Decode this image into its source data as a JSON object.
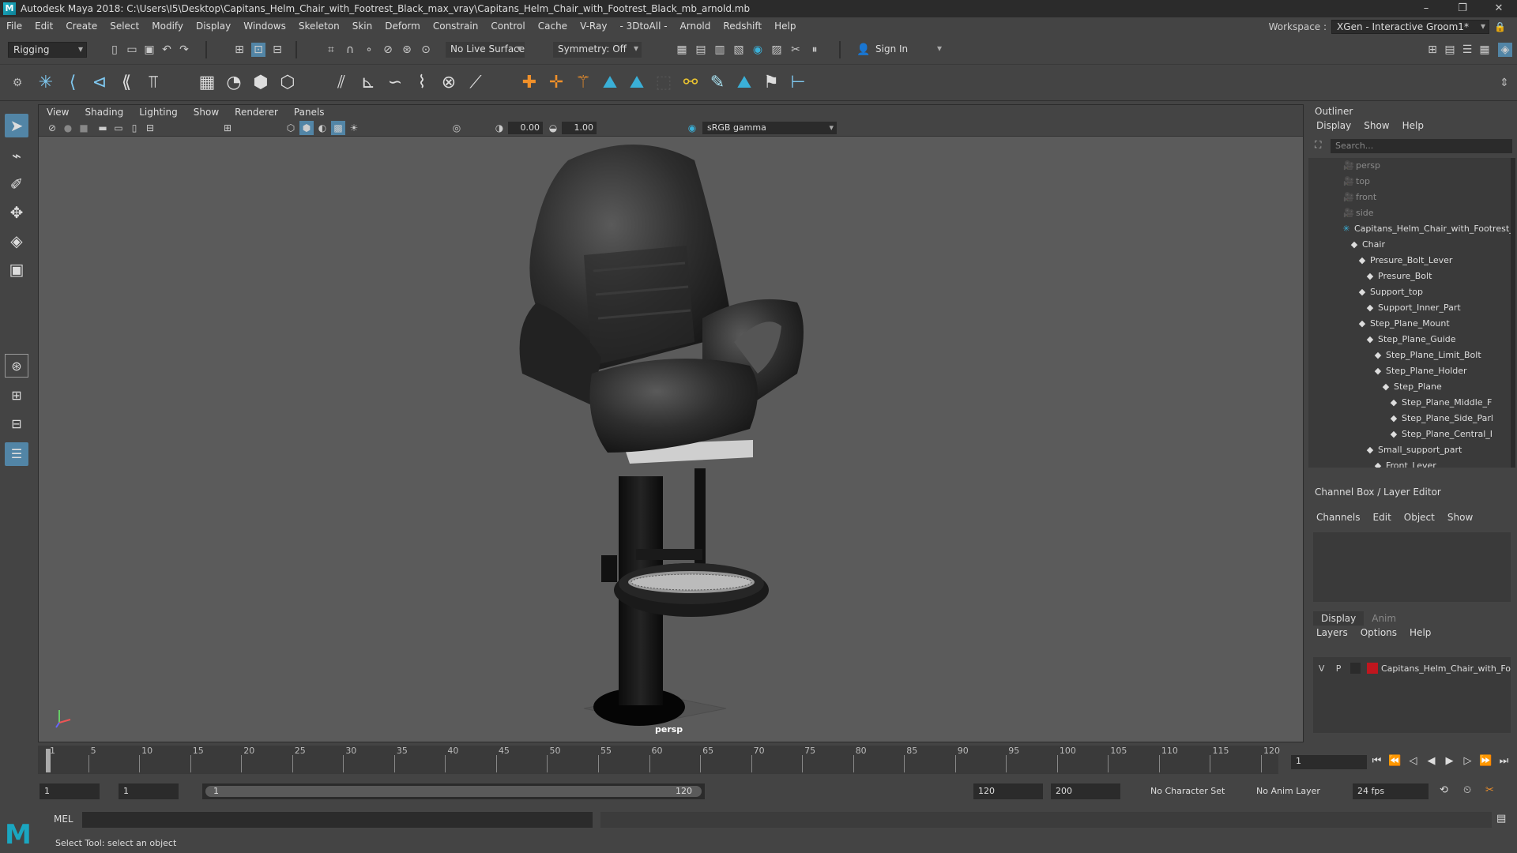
{
  "titlebar": {
    "title": "Autodesk Maya 2018: C:\\Users\\I5\\Desktop\\Capitans_Helm_Chair_with_Footrest_Black_max_vray\\Capitans_Helm_Chair_with_Footrest_Black_mb_arnold.mb",
    "logo": "M",
    "minimize": "–",
    "maximize": "❐",
    "close": "✕"
  },
  "menubar": {
    "items": [
      "File",
      "Edit",
      "Create",
      "Select",
      "Modify",
      "Display",
      "Windows",
      "Skeleton",
      "Skin",
      "Deform",
      "Constrain",
      "Control",
      "Cache",
      "V-Ray",
      "- 3DtoAll -",
      "Arnold",
      "Redshift",
      "Help"
    ],
    "workspace_label": "Workspace :",
    "workspace_value": "XGen - Interactive Groom1*"
  },
  "statusline": {
    "mode": "Rigging",
    "live_surface": "No Live Surface",
    "symmetry": "Symmetry: Off",
    "sign_in": "Sign In"
  },
  "viewport": {
    "menu": [
      "View",
      "Shading",
      "Lighting",
      "Show",
      "Renderer",
      "Panels"
    ],
    "exposure": "0.00",
    "gamma_value": "1.00",
    "color_space": "sRGB gamma",
    "camera_label": "persp"
  },
  "outliner": {
    "title": "Outliner",
    "menu": [
      "Display",
      "Show",
      "Help"
    ],
    "search_placeholder": "Search...",
    "items": [
      {
        "label": "persp",
        "dim": true
      },
      {
        "label": "top",
        "dim": true
      },
      {
        "label": "front",
        "dim": true
      },
      {
        "label": "side",
        "dim": true
      },
      {
        "label": "Capitans_Helm_Chair_with_Footrest_",
        "dim": false
      },
      {
        "label": "Chair",
        "dim": false
      },
      {
        "label": "Presure_Bolt_Lever",
        "dim": false
      },
      {
        "label": "Presure_Bolt",
        "dim": false
      },
      {
        "label": "Support_top",
        "dim": false
      },
      {
        "label": "Support_Inner_Part",
        "dim": false
      },
      {
        "label": "Step_Plane_Mount",
        "dim": false
      },
      {
        "label": "Step_Plane_Guide",
        "dim": false
      },
      {
        "label": "Step_Plane_Limit_Bolt",
        "dim": false
      },
      {
        "label": "Step_Plane_Holder",
        "dim": false
      },
      {
        "label": "Step_Plane",
        "dim": false
      },
      {
        "label": "Step_Plane_Middle_F",
        "dim": false
      },
      {
        "label": "Step_Plane_Side_Parl",
        "dim": false
      },
      {
        "label": "Step_Plane_Central_I",
        "dim": false
      },
      {
        "label": "Small_support_part",
        "dim": false
      },
      {
        "label": "Front_Lever",
        "dim": false
      }
    ]
  },
  "channelbox": {
    "title": "Channel Box / Layer Editor",
    "menu": [
      "Channels",
      "Edit",
      "Object",
      "Show"
    ]
  },
  "layereditor": {
    "tabs": [
      "Display",
      "Anim"
    ],
    "menu": [
      "Layers",
      "Options",
      "Help"
    ],
    "layer": {
      "v": "V",
      "p": "P",
      "name": "Capitans_Helm_Chair_with_Fo",
      "color": "#c0161e"
    }
  },
  "timeslider": {
    "ticks": [
      "1",
      "5",
      "10",
      "15",
      "20",
      "25",
      "30",
      "35",
      "40",
      "45",
      "50",
      "55",
      "60",
      "65",
      "70",
      "75",
      "80",
      "85",
      "90",
      "95",
      "100",
      "105",
      "110",
      "115",
      "120"
    ],
    "current_frame": "1"
  },
  "rangeslider": {
    "start": "1",
    "playback_start": "1",
    "range_start": "1",
    "range_end": "120",
    "playback_end": "120",
    "end": "200",
    "character_set": "No Character Set",
    "anim_layer": "No Anim Layer",
    "fps": "24 fps"
  },
  "cmdline": {
    "label": "MEL"
  },
  "helpline": {
    "text": "Select Tool: select an object"
  }
}
